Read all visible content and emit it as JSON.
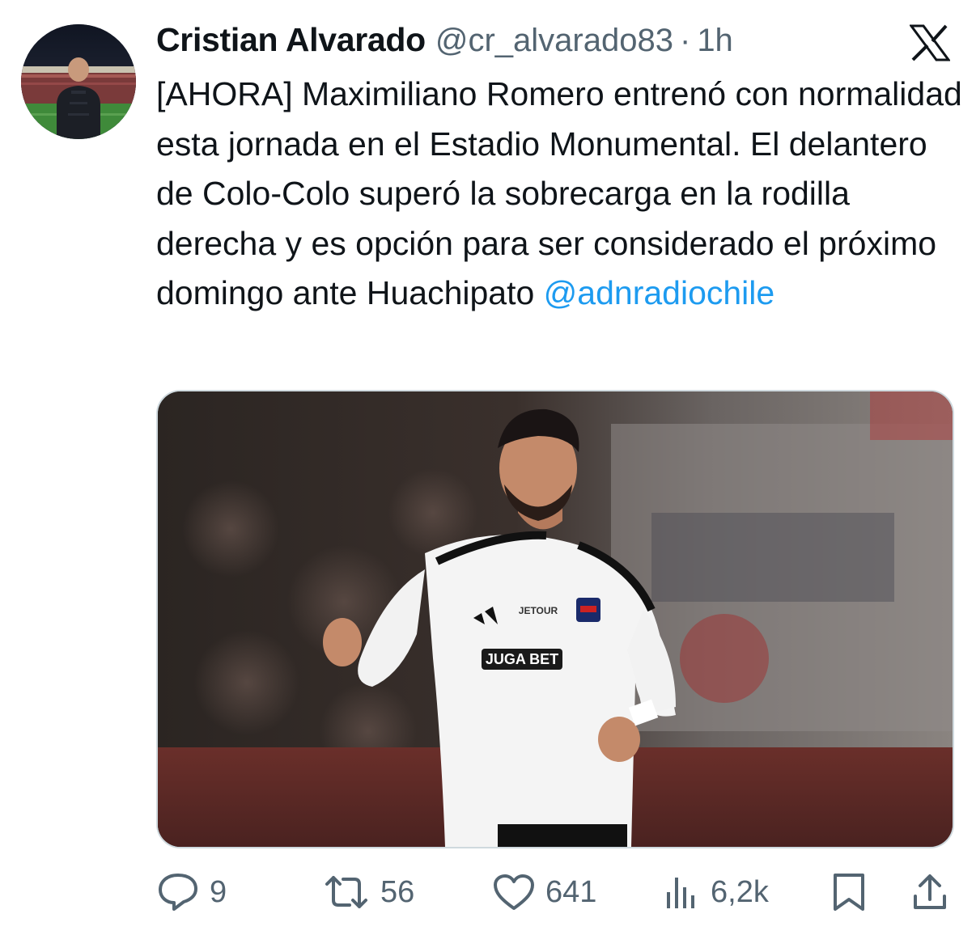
{
  "author": {
    "display_name": "Cristian Alvarado",
    "handle": "@cr_alvarado83",
    "separator": "·",
    "time": "1h"
  },
  "tweet": {
    "text": "[AHORA] Maximiliano Romero entrenó con normalidad esta jornada en el Estadio Monumental. El delantero de Colo-Colo superó la sobrecarga en la rodilla derecha y es opción para ser considerado el próximo domingo ante Huachipato",
    "mention": "@adnradiochile"
  },
  "media": {
    "shirt_sponsor": "JUGA BET",
    "shirt_brand": "JETOUR"
  },
  "actions": {
    "replies": "9",
    "reposts": "56",
    "likes": "641",
    "views": "6,2k"
  },
  "colors": {
    "text": "#0f1419",
    "secondary": "#536471",
    "link": "#1d9bf0"
  },
  "icons": [
    "x-logo-icon",
    "reply-icon",
    "repost-icon",
    "like-icon",
    "views-icon",
    "bookmark-icon",
    "share-icon"
  ]
}
